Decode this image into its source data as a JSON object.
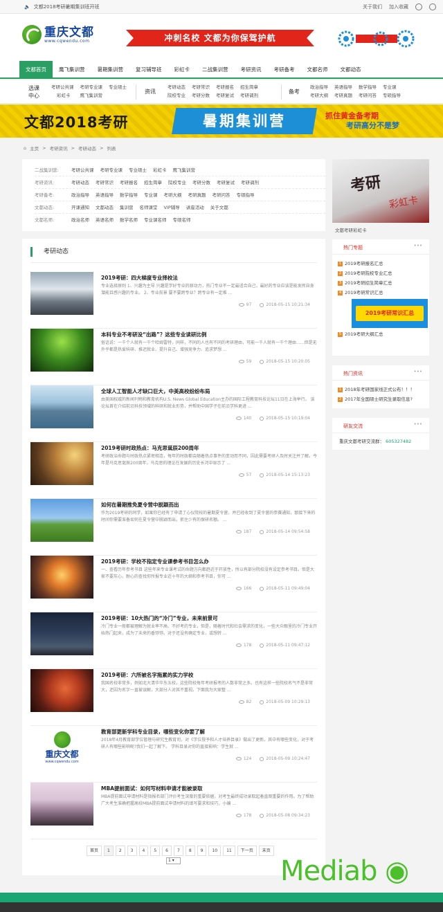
{
  "topbar": {
    "notice": "文都2018考研暑期集训班开班",
    "about": "关于我们",
    "favorite": "加入收藏"
  },
  "header": {
    "logo_cn": "重庆文都",
    "logo_en": "www.cqwendu.com",
    "slogan": "冲刺名校 文都为你保驾护航"
  },
  "nav": [
    {
      "label": "文都首页",
      "active": true
    },
    {
      "label": "鹰飞集训营"
    },
    {
      "label": "暑期集训营"
    },
    {
      "label": "复习辅导班"
    },
    {
      "label": "彩虹卡"
    },
    {
      "label": "二战集训营"
    },
    {
      "label": "考研资讯"
    },
    {
      "label": "考研备考"
    },
    {
      "label": "文都名师"
    },
    {
      "label": "文都动态"
    }
  ],
  "subnav": {
    "g1": {
      "title_a": "选课",
      "title_b": "中心",
      "items": [
        "考研公共课",
        "彩虹卡",
        "考研专业课",
        "鹰飞集训营",
        "专业硕士",
        ""
      ]
    },
    "g2": {
      "title": "资讯",
      "items": [
        "考研动态",
        "院校专业",
        "考研常识",
        "考研分数",
        "考研报名",
        "考研复试",
        "招生简章",
        "考研调剂"
      ]
    },
    "g3": {
      "title": "备考",
      "items": [
        "政治指导",
        "考研大纲",
        "英语指导",
        "考研真题",
        "数学指导",
        "考研问答",
        "专业课",
        "专硕指导"
      ]
    }
  },
  "banner": {
    "left": "文都2018考研",
    "center": "暑期集训营",
    "right_a": "抓住黄金备考期",
    "right_b": "考研高分不是梦"
  },
  "breadcrumb": [
    "主页",
    "考研资讯",
    "考研动态",
    "列表"
  ],
  "filters": [
    {
      "label": "二战集训营:",
      "items": [
        "考研公共课",
        "考研专业课",
        "专业硕士",
        "彩虹卡",
        "鹰飞集训营"
      ]
    },
    {
      "label": "考研资讯:",
      "items": [
        "考研动态",
        "考研常识",
        "考研报名",
        "招生简章",
        "院校专业",
        "考研分数",
        "考研复试",
        "考研调剂"
      ]
    },
    {
      "label": "考研备考:",
      "items": [
        "政治指导",
        "英语指导",
        "数学指导",
        "专业课",
        "考研大纲",
        "考研真题",
        "考研问答",
        "专硕指导"
      ]
    },
    {
      "label": "文都动态:",
      "items": [
        "开课通知",
        "文都动态",
        "集训营",
        "名师课堂",
        "VIP辅导",
        "讲座活动",
        "关于文都"
      ]
    },
    {
      "label": "文都名师:",
      "items": [
        "政治名师",
        "英语名师",
        "数学名师",
        "专业课名师",
        "专硕名师"
      ]
    }
  ],
  "sidebar": {
    "image_title": "考研",
    "image_sub": "彩虹卡",
    "image_caption": "文都考研彩虹卡",
    "hot_topics": {
      "title": "热门专题",
      "items": [
        "2019考研报名汇总",
        "2019考研院校专业汇总",
        "2019考研招生简章汇总",
        "2019考研常识汇总",
        "2019考研大纲汇总"
      ],
      "promo": "2019考研常识汇总"
    },
    "hot_news": {
      "title": "热门资讯",
      "items": [
        "2018年考研国家线正式公布！！！",
        "2017年全国硕士研究生录取信息?"
      ]
    },
    "exchange": {
      "title": "研友交流",
      "text": "重庆文都考研交流群：",
      "qq": "605327482"
    }
  },
  "main": {
    "title": "考研动态",
    "articles": [
      {
        "title": "2019考研：四大梯度专业择校法",
        "desc": "专业选择原则 1、兴趣为主导 兴趣是学好专业的原动力，热门专业不一定最适合自己，最好的专业应该是能发挥自身潜能且感兴趣的专业。 2、专业前景 要不要跨专业？跨专业有一定难 ...",
        "views": "97",
        "time": "2018-05-15 10:21:34"
      },
      {
        "title": "本科专业不考研没“出路”？这些专业读研比例",
        "desc": "俗话说：一千个人就有一千个哈姆雷特，同样，不同的人也有不同的考研理由，可能一千人就有一千个理由......但是无外乎都是热爱科研、推迟就业、提升自己、增强竞争力、追求梦想 ...",
        "views": "59",
        "time": "2018-05-15 10:20:05"
      },
      {
        "title": "全球人工智能人才缺口巨大，中美高校纷纷布局",
        "desc": "由美国权威的新闻刊物和教育机构U.S. News Global Education主办的国际工程教育科技论坛11日在上海举行。 该论坛首在介绍前沿科技领域的科研和就业形势，并帮助中国学子在前沿学科更进 ...",
        "views": "140",
        "time": "2018-05-15 10:19:04"
      },
      {
        "title": "2019考研时政热点：马克思诞辰200周年",
        "desc": "考研政治命题与时政热点紧密相连，每年的时政都会随着热点事件的变动而不同，因此需要考研人及时关注并了解。今年是马克思诞辰200周年，马克思的理论在发展的历史长河中显示了 ...",
        "views": "57",
        "time": "2018-05-14 15:13:23"
      },
      {
        "title": "如何在暑期推免夏令营中脱颖而出",
        "desc": "作为2019考研的同学，如果你已经有了申请了心仪院校的暑期夏令营，并已经收到了夏令营的参赛通知，那接下来的时间你需要准备如何在夏令营中脱颖而出，抓住少有的保研名额。 ...",
        "views": "187",
        "time": "2018-05-14 09:54:58"
      },
      {
        "title": "2019考研：学校不指定专业课参考书目怎么办",
        "desc": "一、查看历年参考书目 这些年来专业课考试的命题方向都趋近于开放性，所以有部分院校没有设定参考书目。但是大家不要灰心，耐心的查找你所报专业近十年的大纲和参考书目，你可 ...",
        "views": "166",
        "time": "2018-05-11 09:49:04"
      },
      {
        "title": "2019考研：10大热门的“冷门”专业，未来前景可",
        "desc": "冷门专业一般都被理解为就业率不高、不好考的专业，但是，随着时代和社会需求的变化，一些大众眼里的冷门专业开始热门起来，成为了未来的香饽饽。对于还没有确定专业，或想转 ...",
        "views": "178",
        "time": "2018-05-11 09:47:12"
      },
      {
        "title": "2019考研：六所被名字拖累的实力学校",
        "desc": "我国名校非常多，例如北大清华华东五校，这些院校每年考研报考的人数非常之多。也有这样一些院校名气不是非常大，还因为名字一直被误解，大部分人对其不重视。下面我为大家整 ...",
        "views": "82",
        "time": "2018-05-09 10:29:13"
      },
      {
        "title": "教育部更新学科专业目录，哪些变化你要了解",
        "desc": "2018年4月教育部学位管理与研究生教育司，对《学位授予和人才培养目录》做出了更新。其中有哪些变化，对于考研人有哪些影响呢?我们一起了解下。 学科目录对你的直接影响：学生就 ...",
        "views": "124",
        "time": "2018-05-09 10:24:47"
      },
      {
        "title": "MBA提前面试：如何写材料申请才能被录取",
        "desc": "MBA提前面试申请材料是指报名部门评价考生深度的重要依据，对考生最终成功录取起着直观重要的作用。为了帮助广大考生准确把握高校MBA提前面试申请材料的填写要求和技巧，小编 ...",
        "views": "178",
        "time": "2018-05-08 09:34:23"
      }
    ]
  },
  "pager": {
    "first": "首页",
    "pages": [
      "1",
      "2",
      "3",
      "4",
      "5",
      "6",
      "7",
      "8",
      "9",
      "10",
      "11"
    ],
    "next": "下一页",
    "last": "末页",
    "select": "1"
  },
  "watermark": "Mediab ◉ cn",
  "colors": {
    "accent": "#2a9e63",
    "red": "#e1251b",
    "brand_blue": "#17479e"
  }
}
